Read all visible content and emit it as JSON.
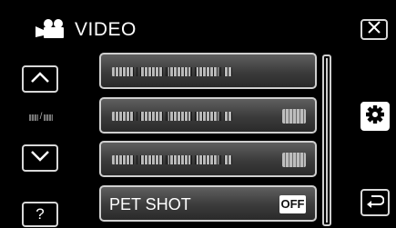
{
  "header": {
    "title": "VIDEO",
    "title_icon": "video-camera-icon"
  },
  "nav": {
    "up_icon": "chevron-up-icon",
    "down_icon": "chevron-down-icon",
    "help_label": "?",
    "close_icon": "close-icon",
    "settings_icon": "gear-icon",
    "back_icon": "return-icon"
  },
  "menu": {
    "items": [
      {
        "label": "",
        "blurred": true,
        "has_badge": false
      },
      {
        "label": "",
        "blurred": true,
        "has_badge": true
      },
      {
        "label": "",
        "blurred": true,
        "has_badge": true
      },
      {
        "label": "PET SHOT",
        "blurred": false,
        "value": "OFF"
      }
    ]
  },
  "colors": {
    "background": "#000000",
    "button_border": "#d8d8d8",
    "item_gradient_top": "#5f5f5f",
    "item_gradient_bottom": "#2a2a2a",
    "badge_bg": "#ffffff"
  }
}
